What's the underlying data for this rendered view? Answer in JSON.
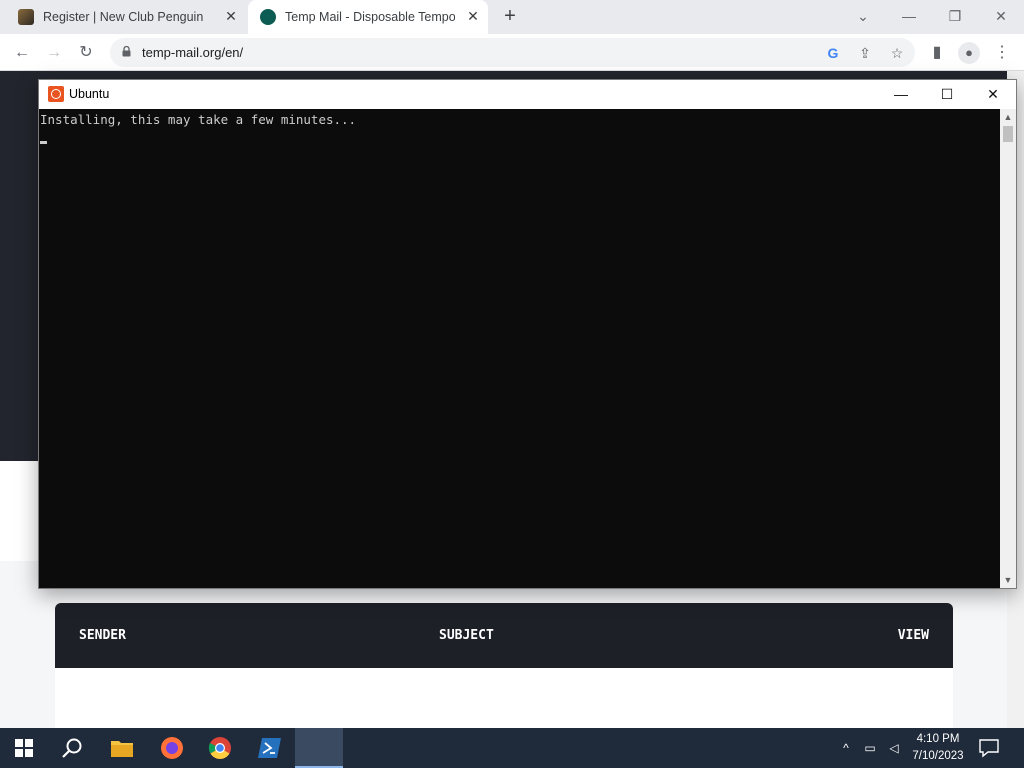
{
  "browser": {
    "tabs": [
      {
        "title": "Register | New Club Penguin",
        "active": false
      },
      {
        "title": "Temp Mail - Disposable Tempora",
        "active": true
      }
    ],
    "url": "temp-mail.org/en/"
  },
  "page": {
    "inbox_columns": {
      "sender": "SENDER",
      "subject": "SUBJECT",
      "view": "VIEW"
    }
  },
  "terminal": {
    "title": "Ubuntu",
    "lines": [
      "Installing, this may take a few minutes..."
    ]
  },
  "taskbar": {
    "time": "4:10 PM",
    "date": "7/10/2023"
  },
  "colors": {
    "ubuntu_orange": "#e95420",
    "taskbar_bg": "#1f2a3a",
    "terminal_bg": "#0c0c0c"
  }
}
